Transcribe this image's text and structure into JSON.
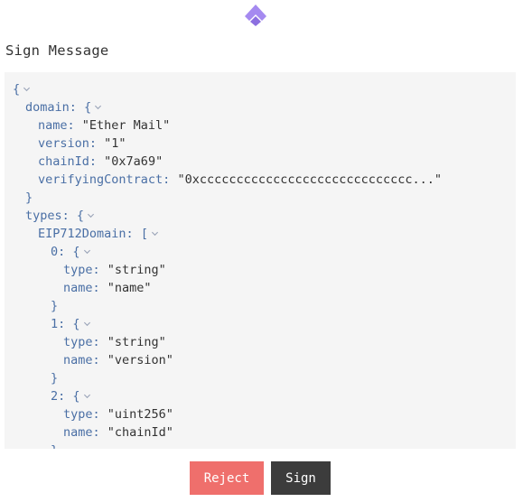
{
  "app": {
    "title": "Sign Message"
  },
  "message_lines": [
    {
      "indent": 0,
      "key": "",
      "sep": "",
      "value": "",
      "open": "{",
      "collapsible": true
    },
    {
      "indent": 1,
      "key": "domain",
      "sep": ": ",
      "value": "",
      "open": "{",
      "collapsible": true
    },
    {
      "indent": 2,
      "key": "name",
      "sep": ": ",
      "value": "\"Ether Mail\"",
      "open": "",
      "collapsible": false
    },
    {
      "indent": 2,
      "key": "version",
      "sep": ": ",
      "value": "\"1\"",
      "open": "",
      "collapsible": false
    },
    {
      "indent": 2,
      "key": "chainId",
      "sep": ": ",
      "value": "\"0x7a69\"",
      "open": "",
      "collapsible": false
    },
    {
      "indent": 2,
      "key": "verifyingContract",
      "sep": ": ",
      "value": "\"0xccccccccccccccccccccccccccccc...\"",
      "open": "",
      "collapsible": false
    },
    {
      "indent": 1,
      "key": "",
      "sep": "",
      "value": "",
      "open": "}",
      "collapsible": false
    },
    {
      "indent": 1,
      "key": "types",
      "sep": ": ",
      "value": "",
      "open": "{",
      "collapsible": true
    },
    {
      "indent": 2,
      "key": "EIP712Domain",
      "sep": ": ",
      "value": "",
      "open": "[",
      "collapsible": true
    },
    {
      "indent": 3,
      "key": "0",
      "sep": ": ",
      "value": "",
      "open": "{",
      "collapsible": true
    },
    {
      "indent": 4,
      "key": "type",
      "sep": ": ",
      "value": "\"string\"",
      "open": "",
      "collapsible": false
    },
    {
      "indent": 4,
      "key": "name",
      "sep": ": ",
      "value": "\"name\"",
      "open": "",
      "collapsible": false
    },
    {
      "indent": 3,
      "key": "",
      "sep": "",
      "value": "",
      "open": "}",
      "collapsible": false
    },
    {
      "indent": 3,
      "key": "1",
      "sep": ": ",
      "value": "",
      "open": "{",
      "collapsible": true
    },
    {
      "indent": 4,
      "key": "type",
      "sep": ": ",
      "value": "\"string\"",
      "open": "",
      "collapsible": false
    },
    {
      "indent": 4,
      "key": "name",
      "sep": ": ",
      "value": "\"version\"",
      "open": "",
      "collapsible": false
    },
    {
      "indent": 3,
      "key": "",
      "sep": "",
      "value": "",
      "open": "}",
      "collapsible": false
    },
    {
      "indent": 3,
      "key": "2",
      "sep": ": ",
      "value": "",
      "open": "{",
      "collapsible": true
    },
    {
      "indent": 4,
      "key": "type",
      "sep": ": ",
      "value": "\"uint256\"",
      "open": "",
      "collapsible": false
    },
    {
      "indent": 4,
      "key": "name",
      "sep": ": ",
      "value": "\"chainId\"",
      "open": "",
      "collapsible": false
    },
    {
      "indent": 3,
      "key": "",
      "sep": "",
      "value": "",
      "open": "}",
      "collapsible": false
    }
  ],
  "buttons": {
    "reject": "Reject",
    "sign": "Sign"
  },
  "colors": {
    "brand": "#9b7fe6",
    "reject": "#ef6f6c",
    "sign": "#3c3c3c",
    "key": "#4a6fa5",
    "panel": "#f5f5f5"
  },
  "icons": {
    "logo": "brand-logo-icon",
    "collapse": "chevron-down-icon"
  }
}
